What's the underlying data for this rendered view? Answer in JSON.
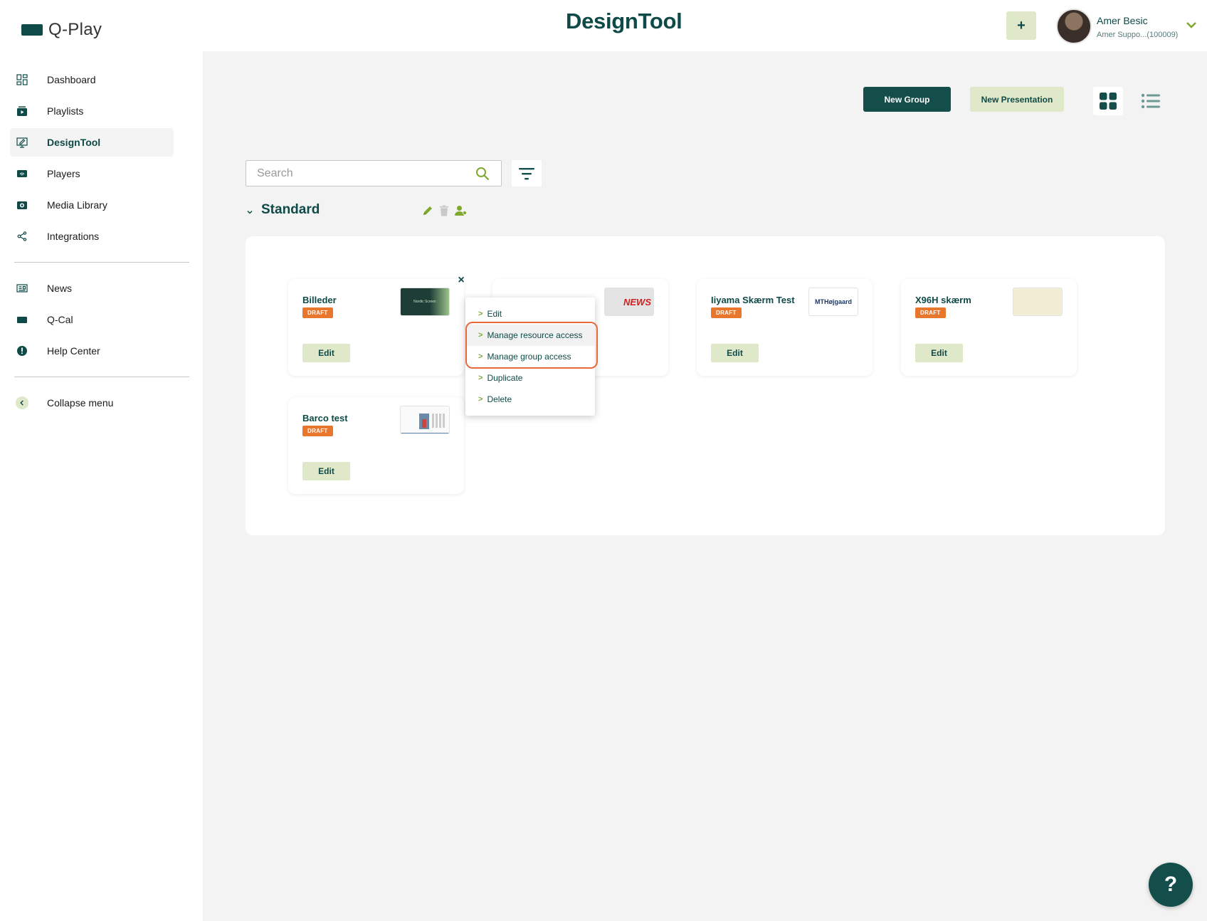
{
  "app": {
    "logo_text": "Q-Play",
    "page_title": "DesignTool",
    "add_button": "+"
  },
  "user": {
    "name": "Amer Besic",
    "subtitle": "Amer Suppo...(100009)"
  },
  "sidebar": {
    "items": [
      {
        "label": "Dashboard",
        "icon": "dashboard-icon"
      },
      {
        "label": "Playlists",
        "icon": "playlists-icon"
      },
      {
        "label": "DesignTool",
        "icon": "designtool-icon",
        "active": true
      },
      {
        "label": "Players",
        "icon": "players-icon"
      },
      {
        "label": "Media Library",
        "icon": "media-library-icon"
      },
      {
        "label": "Integrations",
        "icon": "integrations-icon"
      }
    ],
    "secondary": [
      {
        "label": "News",
        "icon": "news-icon"
      },
      {
        "label": "Q-Cal",
        "icon": "qcal-icon"
      },
      {
        "label": "Help Center",
        "icon": "help-center-icon"
      }
    ],
    "collapse_label": "Collapse menu"
  },
  "toolbar": {
    "new_group": "New Group",
    "new_presentation": "New Presentation"
  },
  "search": {
    "placeholder": "Search"
  },
  "group": {
    "title": "Standard"
  },
  "cards": [
    {
      "title": "Billeder",
      "badge": "DRAFT",
      "edit": "Edit",
      "thumb_text": "Nordic Screen"
    },
    {
      "title": "",
      "badge": "",
      "edit": "",
      "thumb_text": "NEWS"
    },
    {
      "title": "Iiyama Skærm Test",
      "badge": "DRAFT",
      "edit": "Edit",
      "thumb_text": "MTHøjgaard"
    },
    {
      "title": "X96H skærm",
      "badge": "DRAFT",
      "edit": "Edit",
      "thumb_text": ""
    },
    {
      "title": "Barco test",
      "badge": "DRAFT",
      "edit": "Edit",
      "thumb_text": ""
    }
  ],
  "context_menu": {
    "items": [
      "Edit",
      "Manage resource access",
      "Manage group access",
      "Duplicate",
      "Delete"
    ]
  },
  "help_button": "?",
  "colors": {
    "brand": "#0e4a47",
    "accent_light": "#dfe8c8",
    "badge": "#e8762d",
    "highlight": "#e86a3a",
    "icon_green": "#7fa82e"
  }
}
